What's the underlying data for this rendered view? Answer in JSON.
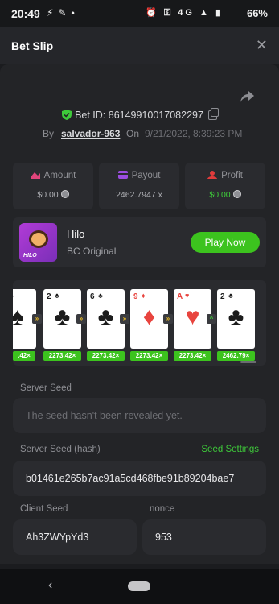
{
  "status_bar": {
    "time": "20:49",
    "network": "4G",
    "battery": "66%"
  },
  "header": {
    "title": "Bet Slip",
    "close": "✕"
  },
  "bet": {
    "id_label": "Bet ID: 86149910017082297",
    "by_label": "By",
    "user": "salvador-963",
    "on_label": "On",
    "date": "9/21/2022, 8:39:23 PM"
  },
  "stats": {
    "amount": {
      "label": "Amount",
      "value": "$0.00"
    },
    "payout": {
      "label": "Payout",
      "value": "2462.7947 x"
    },
    "profit": {
      "label": "Profit",
      "value": "$0.00"
    }
  },
  "game": {
    "name": "Hilo",
    "subtitle": "BC Original",
    "play_label": "Play Now",
    "thumb_label": "HILO"
  },
  "cards": [
    {
      "rank": "",
      "suit": "♠",
      "color": "black"
    },
    {
      "rank": "2",
      "suit": "♣",
      "color": "black"
    },
    {
      "rank": "6",
      "suit": "♣",
      "color": "black"
    },
    {
      "rank": "9",
      "suit": "♦",
      "color": "red"
    },
    {
      "rank": "A",
      "suit": "♥",
      "color": "red"
    },
    {
      "rank": "2",
      "suit": "♣",
      "color": "black"
    }
  ],
  "arrows": [
    "»",
    "»",
    "»",
    "»",
    "^"
  ],
  "multipliers": [
    ".42×",
    "2273.42×",
    "2273.42×",
    "2273.42×",
    "2273.42×",
    "2462.79×"
  ],
  "fair": {
    "server_seed_label": "Server Seed",
    "server_seed_placeholder": "The seed hasn't been revealed yet.",
    "server_hash_label": "Server Seed (hash)",
    "seed_settings_label": "Seed Settings",
    "server_hash": "b01461e265b7ac91a5cd468fbe91b89204bae7",
    "client_seed_label": "Client Seed",
    "client_seed": "Ah3ZWYpYd3",
    "nonce_label": "nonce",
    "nonce": "953"
  },
  "colors": {
    "accent_green": "#3cc31e",
    "background": "#1b1c1f",
    "card": "#2a2b2f"
  }
}
